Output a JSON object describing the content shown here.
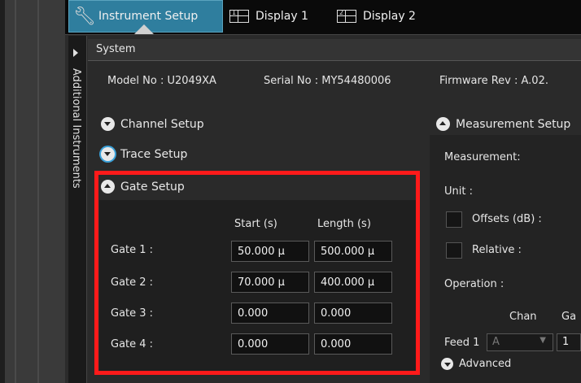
{
  "tabs": {
    "instrument_setup": "Instrument Setup",
    "display1": "Display 1",
    "display2": "Display 2",
    "display1_num": "1",
    "display2_num": "2"
  },
  "side_panel": {
    "label": "Additional Instruments"
  },
  "system": {
    "title": "System",
    "model": "Model No :  U2049XA",
    "serial": "Serial No :  MY54480006",
    "firmware": "Firmware Rev :  A.02."
  },
  "sections": {
    "channel_setup": "Channel Setup",
    "trace_setup": "Trace Setup",
    "gate_setup": "Gate Setup",
    "measurement_setup": "Measurement Setup"
  },
  "gate_table": {
    "col_start": "Start (s)",
    "col_length": "Length (s)",
    "rows": [
      {
        "label": "Gate 1 :",
        "start": "50.000 µ",
        "length": "500.000 µ"
      },
      {
        "label": "Gate 2 :",
        "start": "70.000 µ",
        "length": "400.000 µ"
      },
      {
        "label": "Gate 3 :",
        "start": "0.000",
        "length": "0.000"
      },
      {
        "label": "Gate 4 :",
        "start": "0.000",
        "length": "0.000"
      }
    ]
  },
  "measurement": {
    "measurement_label": "Measurement:",
    "unit_label": "Unit :",
    "offsets_label": "Offsets (dB) :",
    "relative_label": "Relative :",
    "operation_label": "Operation :",
    "chan_header": "Chan",
    "gate_header": "Ga",
    "feed_label": "Feed 1",
    "feed_chan": "A",
    "feed_gate": "1",
    "advanced": "Advanced"
  },
  "colors": {
    "highlight": "#ff1a1a",
    "tab_active": "#2f7e9e"
  }
}
